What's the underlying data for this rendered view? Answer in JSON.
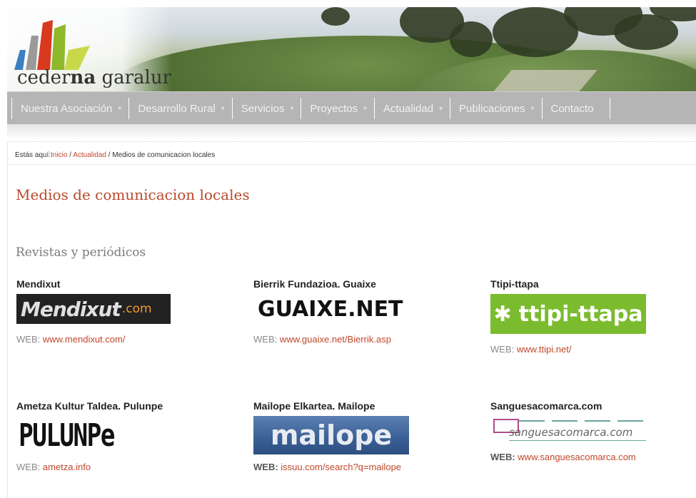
{
  "header": {
    "logo_text_pre": "cederna",
    "logo_text_bold": "na",
    "logo_text_post": "garalur",
    "logo_full": "cederna garalur"
  },
  "nav": {
    "items": [
      {
        "label": "Nuestra Asociación",
        "has_dropdown": true
      },
      {
        "label": "Desarrollo Rural",
        "has_dropdown": true
      },
      {
        "label": "Servicios",
        "has_dropdown": true
      },
      {
        "label": "Proyectos",
        "has_dropdown": true
      },
      {
        "label": "Actualidad",
        "has_dropdown": true
      },
      {
        "label": "Publicaciones",
        "has_dropdown": true
      },
      {
        "label": "Contacto",
        "has_dropdown": false
      }
    ]
  },
  "breadcrumb": {
    "prefix": "Estás aquí:",
    "home": "Inicio",
    "sep": " / ",
    "section": "Actualidad",
    "current": "Medios de comunicacion locales"
  },
  "page": {
    "title": "Medios de comunicacion locales",
    "section_title": "Revistas y periódicos"
  },
  "items": [
    {
      "name": "Mendixut",
      "logo_text": "Mendixut",
      "logo_domain": ".com",
      "web_label": "WEB:",
      "url": "www.mendixut.com/"
    },
    {
      "name": "Bierrik Fundazioa. Guaixe",
      "logo_text": "GUAIXE.NET",
      "web_label": "WEB:",
      "url": "www.guaixe.net/Bierrik.asp"
    },
    {
      "name": "Ttipi-ttapa",
      "logo_text": "ttipi-ttapa",
      "web_label": "WEB:",
      "url": "www.ttipi.net/"
    },
    {
      "name": "Ametza Kultur Taldea. Pulunpe",
      "logo_text": "PULUNPe",
      "web_label": "WEB:",
      "url": "ametza.info"
    },
    {
      "name": "Mailope Elkartea. Mailope",
      "logo_text": "mailope",
      "web_label": "WEB:",
      "url": "issuu.com/search?q=mailope"
    },
    {
      "name": "Sanguesacomarca.com",
      "logo_text": "sanguesacomarca.com",
      "web_label": "WEB:",
      "url": "www.sanguesacomarca.com"
    }
  ],
  "colors": {
    "accent": "#c0472a",
    "nav_bg": "#b5b5b5",
    "ttipi_green": "#7bbc2e",
    "mailope_blue": "#3a5f95"
  }
}
